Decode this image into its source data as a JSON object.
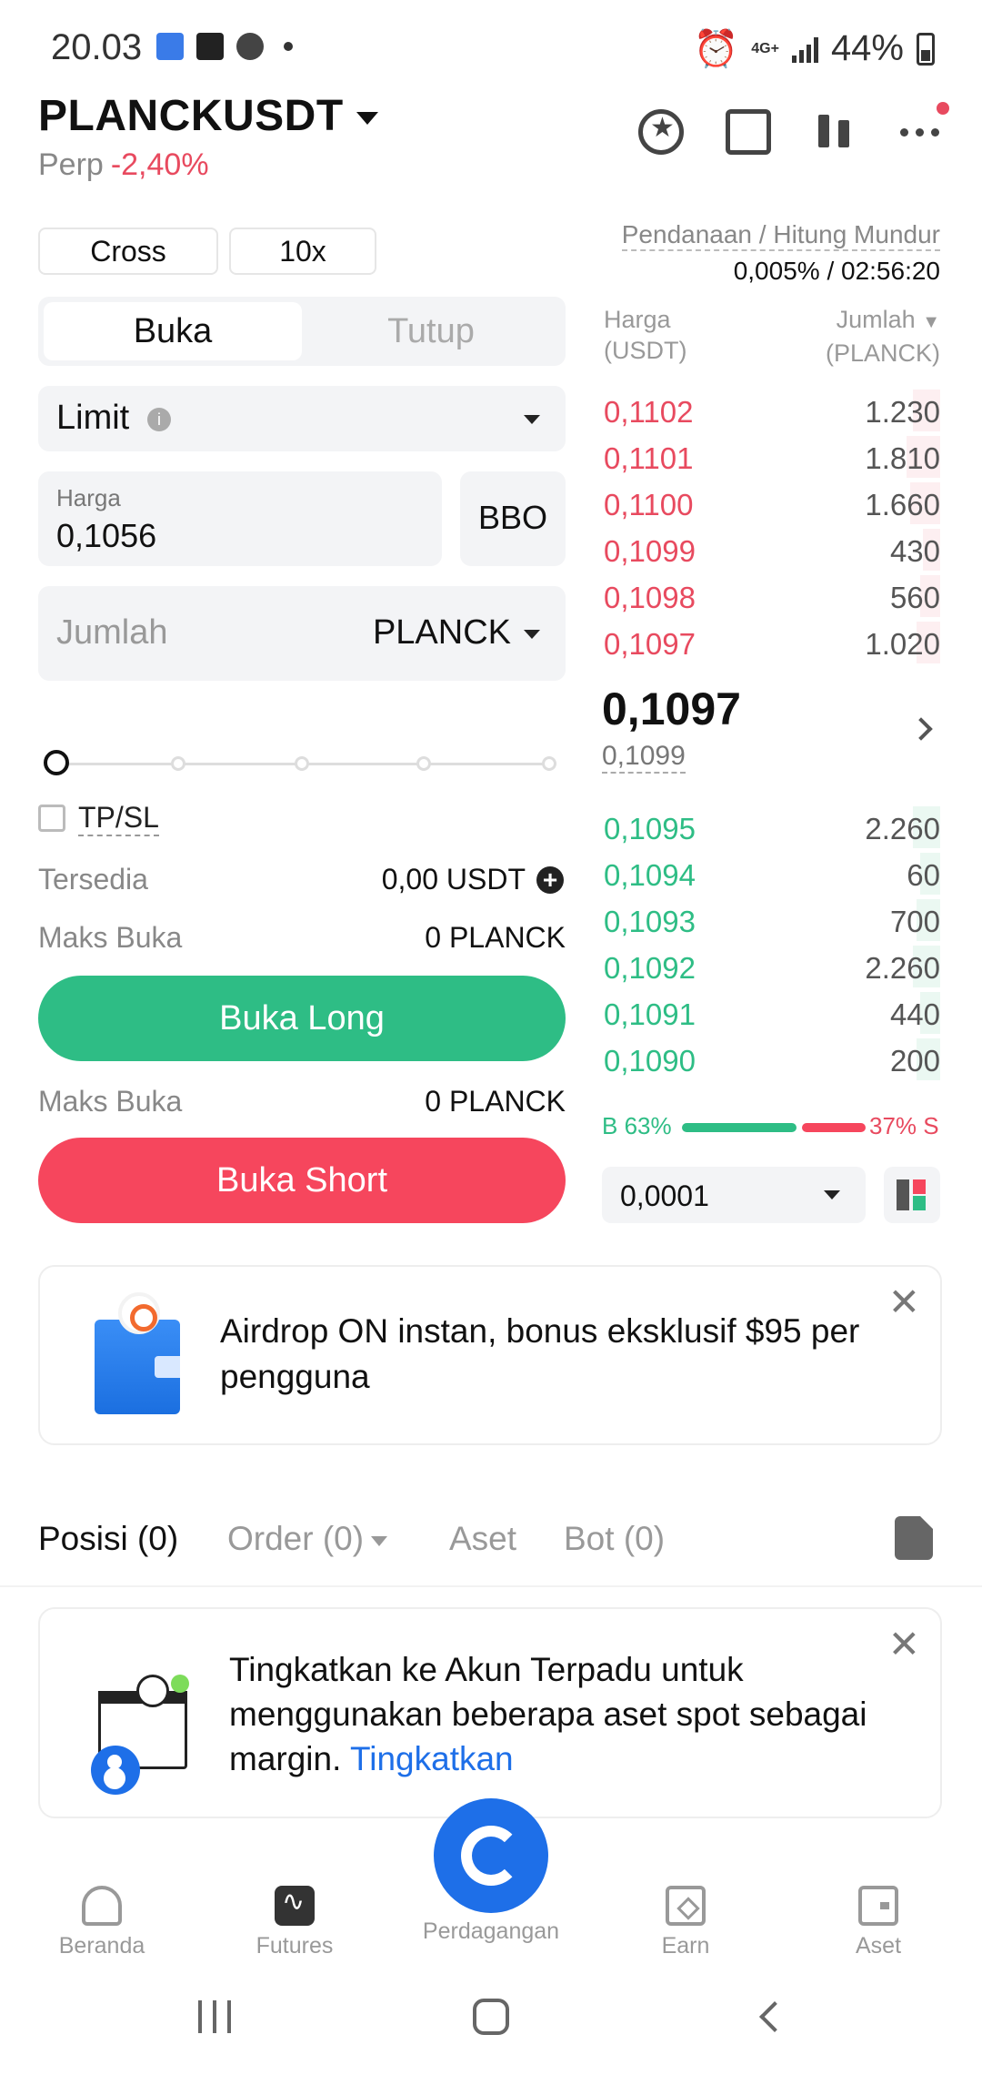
{
  "status_bar": {
    "time": "20.03",
    "network": "4G+",
    "battery": "44%"
  },
  "header": {
    "pair": "PLANCKUSDT",
    "type": "Perp",
    "change": "-2,40%"
  },
  "margin": {
    "mode": "Cross",
    "leverage": "10x"
  },
  "position_tabs": {
    "open": "Buka",
    "close": "Tutup"
  },
  "order_type": {
    "label": "Limit"
  },
  "price_field": {
    "label": "Harga",
    "value": "0,1056",
    "bbo": "BBO"
  },
  "amount_field": {
    "placeholder": "Jumlah",
    "unit": "PLANCK"
  },
  "slider": {
    "value_percent": 0
  },
  "tpsl": {
    "label": "TP/SL"
  },
  "available": {
    "label": "Tersedia",
    "value": "0,00 USDT"
  },
  "max_open_long": {
    "label": "Maks Buka",
    "value": "0 PLANCK"
  },
  "max_open_short": {
    "label": "Maks Buka",
    "value": "0 PLANCK"
  },
  "buttons": {
    "long": "Buka Long",
    "short": "Buka Short"
  },
  "funding": {
    "title": "Pendanaan / Hitung Mundur",
    "value": "0,005% / 02:56:20"
  },
  "orderbook": {
    "price_header": "Harga",
    "price_unit": "(USDT)",
    "qty_header": "Jumlah",
    "qty_unit": "(PLANCK)",
    "asks": [
      {
        "price": "0,1102",
        "qty": "1.230",
        "depth": 0.08
      },
      {
        "price": "0,1101",
        "qty": "1.810",
        "depth": 0.1
      },
      {
        "price": "0,1100",
        "qty": "1.660",
        "depth": 0.09
      },
      {
        "price": "0,1099",
        "qty": "430",
        "depth": 0.05
      },
      {
        "price": "0,1098",
        "qty": "560",
        "depth": 0.06
      },
      {
        "price": "0,1097",
        "qty": "1.020",
        "depth": 0.07
      }
    ],
    "last_price": "0,1097",
    "mark_price": "0,1099",
    "bids": [
      {
        "price": "0,1095",
        "qty": "2.260",
        "depth": 0.08
      },
      {
        "price": "0,1094",
        "qty": "60",
        "depth": 0.06
      },
      {
        "price": "0,1093",
        "qty": "700",
        "depth": 0.07
      },
      {
        "price": "0,1092",
        "qty": "2.260",
        "depth": 0.08
      },
      {
        "price": "0,1091",
        "qty": "440",
        "depth": 0.06
      },
      {
        "price": "0,1090",
        "qty": "200",
        "depth": 0.07
      }
    ],
    "buy_ratio": "B 63%",
    "sell_ratio": "37% S",
    "precision": "0,0001"
  },
  "banner_airdrop": {
    "text": "Airdrop ON instan, bonus eksklusif $95 per pengguna"
  },
  "bottom_tabs": {
    "positions": "Posisi (0)",
    "orders": "Order (0)",
    "assets": "Aset",
    "bots": "Bot (0)"
  },
  "banner_upgrade": {
    "text": "Tingkatkan ke Akun Terpadu untuk menggunakan beberapa aset spot sebagai margin.",
    "link": "Tingkatkan"
  },
  "nav": {
    "home": "Beranda",
    "futures": "Futures",
    "trade": "Perdagangan",
    "earn": "Earn",
    "assets": "Aset"
  },
  "colors": {
    "buy": "#2ebd85",
    "sell": "#f6465d",
    "accent": "#1e6fe8"
  }
}
